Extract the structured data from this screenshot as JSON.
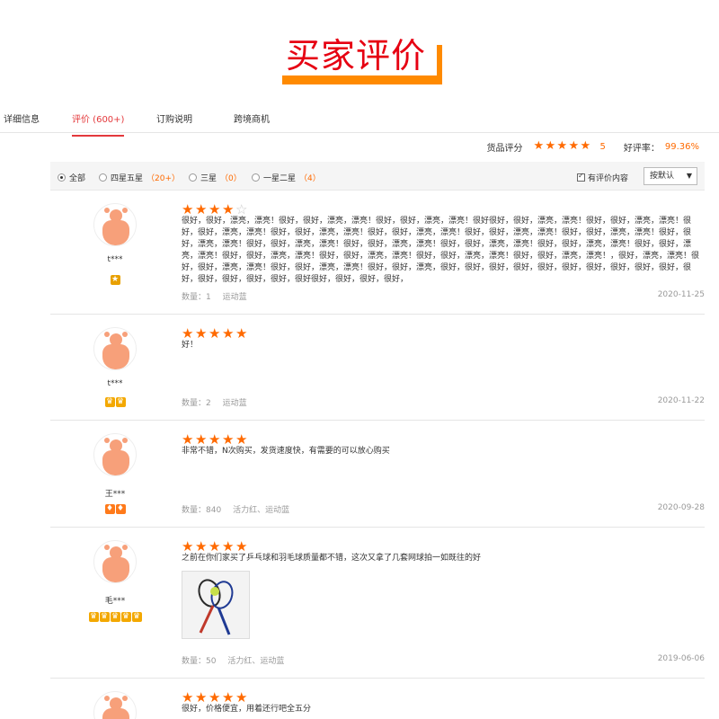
{
  "banner": {
    "title": "买家评价"
  },
  "tabs": [
    {
      "label": "详细信息"
    },
    {
      "label": "评价 (600+)"
    },
    {
      "label": "订购说明"
    },
    {
      "label": "跨境商机"
    }
  ],
  "summary": {
    "label": "货品评分",
    "score": "5",
    "rate_label": "好评率：",
    "rate_value": "99.36%",
    "stars": 5
  },
  "filter": {
    "options": [
      {
        "label": "全部",
        "count": "",
        "selected": true
      },
      {
        "label": "四星五星",
        "count": "（20+）",
        "selected": false
      },
      {
        "label": "三星",
        "count": "（0）",
        "selected": false
      },
      {
        "label": "一星二星",
        "count": "（4）",
        "selected": false
      }
    ],
    "checkbox_label": "有评价内容",
    "sort_value": "按默认"
  },
  "reviews": [
    {
      "user": "t***",
      "badges": [
        "medal"
      ],
      "stars": 4,
      "content": "很好，很好，漂亮，漂亮！很好，很好，漂亮，漂亮！很好，很好，漂亮，漂亮！很好很好，很好，漂亮，漂亮！很好，很好，漂亮，漂亮！很好，很好，漂亮，漂亮！很好，很好，漂亮，漂亮！很好，很好，漂亮，漂亮！很好，很好，漂亮，漂亮！很好，很好，漂亮，漂亮！很好，很好，漂亮，漂亮！很好，很好，漂亮，漂亮！很好，很好，漂亮，漂亮！很好，很好，漂亮，漂亮！很好，很好，漂亮，漂亮！很好，很好，漂亮，漂亮！很好，很好，漂亮，漂亮！很好，很好，漂亮，漂亮！很好，很好，漂亮，漂亮！很好，很好，漂亮，漂亮！，很好，漂亮，漂亮！很好，很好，漂亮，漂亮！很好，很好，漂亮，漂亮！很好，很好，漂亮，很好，很好，很好，很好，很好，很好，很好，很好，很好，很好，很好，很好，很好，很好，很好，很好很好，很好，很好，很好，",
      "quantity": "数量：1",
      "tag": "运动蓝",
      "date": "2020-11-25"
    },
    {
      "user": "t***",
      "badges": [
        "crown",
        "crown"
      ],
      "stars": 5,
      "content": "好！",
      "quantity": "数量：2",
      "tag": "运动蓝",
      "date": "2020-11-22"
    },
    {
      "user": "王***",
      "badges": [
        "diamond",
        "diamond"
      ],
      "stars": 5,
      "content": "非常不错，N次购买，发货速度快，有需要的可以放心购买",
      "quantity": "数量：840",
      "tag": "活力红、运动蓝",
      "date": "2020-09-28"
    },
    {
      "user": "毛***",
      "badges": [
        "crown",
        "crown",
        "crown",
        "crown",
        "crown"
      ],
      "stars": 5,
      "content": "之前在你们家买了乒乓球和羽毛球质量都不错，这次又拿了几套网球拍一如既往的好",
      "quantity": "数量：50",
      "tag": "活力红、运动蓝",
      "date": "2019-06-06",
      "has_photo": true
    },
    {
      "user": "",
      "badges": [],
      "stars": 5,
      "content": "很好，价格便宜，用着还行吧全五分",
      "quantity": "",
      "tag": "",
      "date": ""
    }
  ],
  "colors": {
    "accent": "#ff6a00",
    "active_tab": "#e4393c",
    "banner_text": "#e60012",
    "banner_shadow": "#ff8a00"
  }
}
